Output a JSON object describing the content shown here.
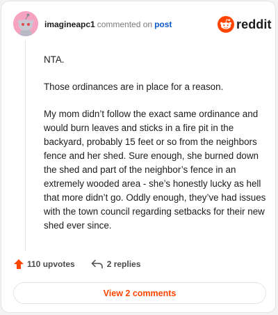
{
  "comment": {
    "username": "imagineapc1",
    "action_text": "commented on",
    "post_link": "post",
    "paragraphs": [
      "NTA.",
      "Those ordinances are in place for a reason.",
      "My mom didn’t follow the exact same ordinance and would burn leaves and sticks in a fire pit in the backyard, probably 15 feet or so from the neighbors fence and her shed. Sure enough, she burned down the shed and part of the neighbor’s fence in an extremely wooded area - she’s honestly lucky as hell that more didn’t go. Oddly enough, they’ve had issues with the town council regarding setbacks for their new shed ever since."
    ],
    "upvotes_label": "110 upvotes",
    "replies_label": "2 replies",
    "view_comments_label": "View 2 comments"
  },
  "brand": {
    "logo_text": "reddit",
    "accent_color": "#ff4500"
  },
  "icons": {
    "avatar": "snoo-avatar",
    "logo": "reddit-snoo-icon",
    "upvote": "upvote-arrow-icon",
    "reply": "reply-arrow-icon"
  }
}
